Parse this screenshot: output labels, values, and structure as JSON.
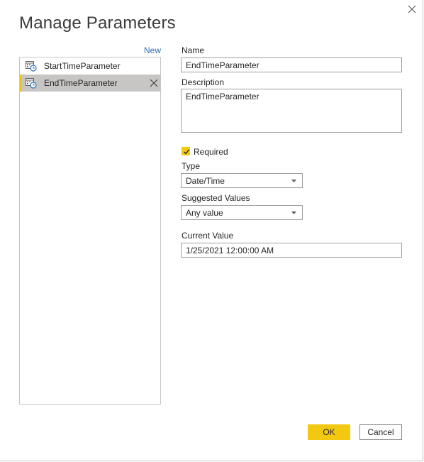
{
  "dialog": {
    "title": "Manage Parameters",
    "new_link": "New",
    "close_icon": "close-icon"
  },
  "parameters": [
    {
      "label": "StartTimeParameter",
      "icon": "calendar-clock-icon",
      "selected": false
    },
    {
      "label": "EndTimeParameter",
      "icon": "calendar-clock-icon",
      "selected": true
    }
  ],
  "form": {
    "name_label": "Name",
    "name_value": "EndTimeParameter",
    "description_label": "Description",
    "description_value": "EndTimeParameter",
    "required_label": "Required",
    "required_checked": true,
    "type_label": "Type",
    "type_value": "Date/Time",
    "suggested_label": "Suggested Values",
    "suggested_value": "Any value",
    "current_label": "Current Value",
    "current_value": "1/25/2021 12:00:00 AM"
  },
  "buttons": {
    "ok": "OK",
    "cancel": "Cancel"
  },
  "colors": {
    "accent": "#f2c811",
    "selection": "#c8c6c4",
    "link": "#2b6fb0"
  }
}
